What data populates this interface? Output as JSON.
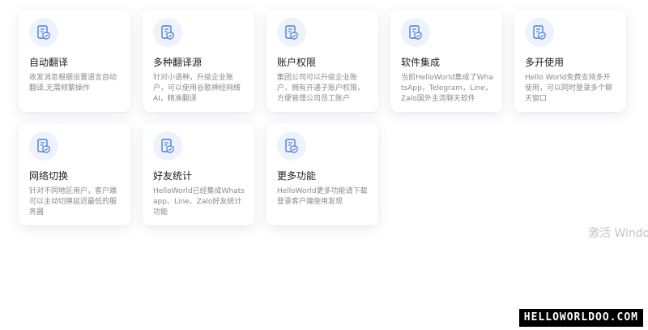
{
  "features": [
    {
      "icon": "document-shield-icon",
      "title": "自动翻译",
      "desc": "收发消息根据设置语言自动翻译,无需频繁操作"
    },
    {
      "icon": "document-shield-icon",
      "title": "多种翻译源",
      "desc": "针对小语种，升级企业账户，可以使用谷歌神经网络AI，精准翻译"
    },
    {
      "icon": "document-shield-icon",
      "title": "账户权限",
      "desc": "集团公司可以升级企业账户，拥有开通子账户权限，方便管理公司员工账户"
    },
    {
      "icon": "document-shield-icon",
      "title": "软件集成",
      "desc": "当前HelloWorld集成了WhatsApp，Telegram，Line，Zalo国外主流聊天软件"
    },
    {
      "icon": "document-shield-icon",
      "title": "多开使用",
      "desc": "Hello World免费支持多开使用，可以同时登录多个聊天窗口"
    },
    {
      "icon": "document-shield-icon",
      "title": "网络切换",
      "desc": "针对不同地区用户，客户端可以主动切换延迟最低的服务器"
    },
    {
      "icon": "document-shield-icon",
      "title": "好友统计",
      "desc": "HelloWorld已经集成Whatsapp、Line、Zalo好友统计功能"
    },
    {
      "icon": "document-shield-icon",
      "title": "更多功能",
      "desc": "HelloWorld更多功能请下载登录客户端使用发现"
    }
  ],
  "watermark_text": "激活 Window",
  "brand_text": "HELLOWORLDOO.COM",
  "colors": {
    "icon_blue": "#4a7fd6",
    "icon_bg": "#eef3fb"
  }
}
